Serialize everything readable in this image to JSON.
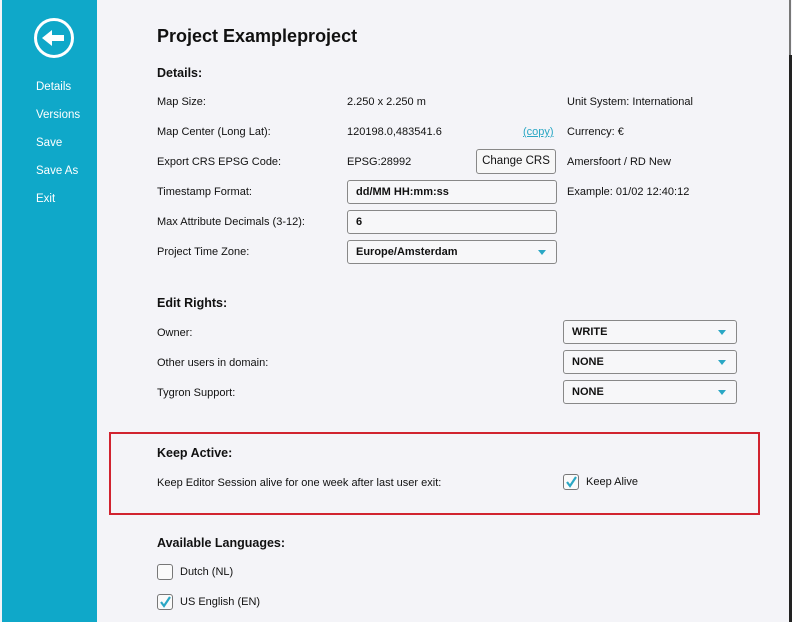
{
  "sidebar": {
    "back_icon": "arrow-left-circle-icon",
    "items": [
      {
        "label": "Details"
      },
      {
        "label": "Versions"
      },
      {
        "label": "Save"
      },
      {
        "label": "Save As"
      },
      {
        "label": "Exit"
      }
    ]
  },
  "page": {
    "title": "Project Exampleproject"
  },
  "details": {
    "heading": "Details:",
    "map_size_label": "Map Size:",
    "map_size_value": "2.250 x 2.250 m",
    "unit_system": "Unit System: International",
    "map_center_label": "Map Center (Long Lat):",
    "map_center_value": "120198.0,483541.6",
    "copy_link": "(copy)",
    "currency": "Currency: €",
    "export_crs_label": "Export CRS EPSG Code:",
    "export_crs_value": "EPSG:28992",
    "change_crs_button": "Change CRS",
    "crs_name": "Amersfoort / RD New",
    "timestamp_label": "Timestamp Format:",
    "timestamp_value": "dd/MM HH:mm:ss",
    "timestamp_example": "Example: 01/02 12:40:12",
    "decimals_label": "Max Attribute Decimals (3-12):",
    "decimals_value": "6",
    "timezone_label": "Project Time Zone:",
    "timezone_value": "Europe/Amsterdam"
  },
  "edit_rights": {
    "heading": "Edit Rights:",
    "owner_label": "Owner:",
    "owner_value": "WRITE",
    "domain_label": "Other users in domain:",
    "domain_value": "NONE",
    "support_label": "Tygron Support:",
    "support_value": "NONE"
  },
  "keep_active": {
    "heading": "Keep Active:",
    "description": "Keep Editor Session alive for one week after last user exit:",
    "checkbox_label": "Keep Alive",
    "checked": true
  },
  "languages": {
    "heading": "Available Languages:",
    "items": [
      {
        "label": "Dutch (NL)",
        "checked": false
      },
      {
        "label": "US English (EN)",
        "checked": true
      }
    ]
  },
  "colors": {
    "sidebar": "#0fa8c9",
    "accent": "#2aa7c4",
    "highlight_border": "#d1232f",
    "background": "#f4f4f8"
  }
}
